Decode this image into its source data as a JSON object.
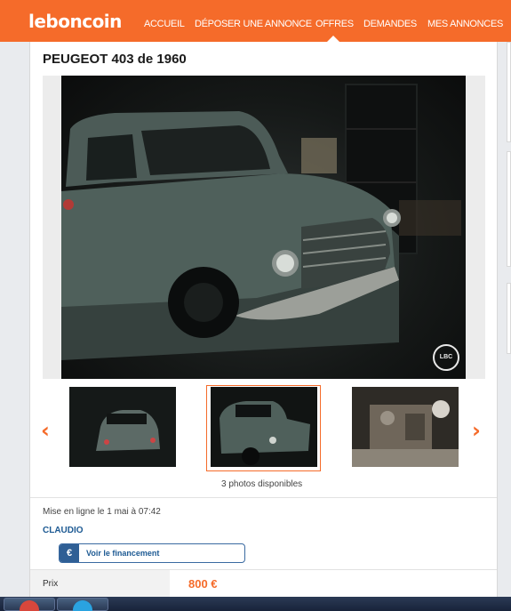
{
  "header": {
    "logo": "leboncoin",
    "nav": [
      "ACCUEIL",
      "DÉPOSER UNE ANNONCE",
      "OFFRES",
      "DEMANDES",
      "MES ANNONCES"
    ],
    "active_nav": "OFFRES"
  },
  "listing": {
    "title": "PEUGEOT 403 de 1960",
    "watermark": "LBC",
    "photos_count_label": "3 photos disponibles",
    "posted": "Mise en ligne le 1 mai à 07:42",
    "seller": "CLAUDIO",
    "financing_button": "Voir le financement",
    "price_label": "Prix",
    "price_value": "800 €"
  },
  "colors": {
    "accent": "#f56b2a",
    "link_blue": "#1d5a93"
  },
  "icons": {
    "prev": "chevron-left-icon",
    "next": "chevron-right-icon",
    "euro": "euro-icon"
  }
}
